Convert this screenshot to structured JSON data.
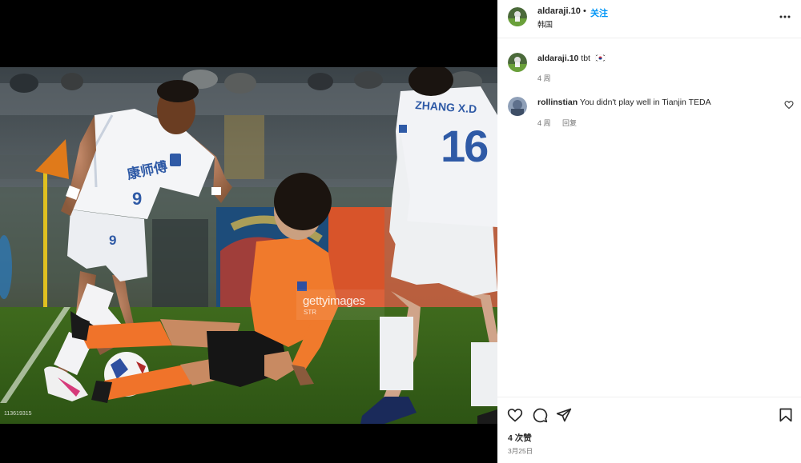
{
  "media": {
    "watermark": "gettyimages",
    "watermark_credit": "STR",
    "image_id": "113619315",
    "jersey_print_front": "康师傅",
    "front_number": "9",
    "back_name": "ZHANG X.D",
    "back_number": "16",
    "shorts_number": "9"
  },
  "post": {
    "username": "aldaraji.10",
    "dot": "•",
    "follow_label": "关注",
    "location": "韩国"
  },
  "comments": [
    {
      "username": "aldaraji.10",
      "text": "tbt",
      "flag": "south-korea-flag",
      "time": "4 周"
    },
    {
      "username": "rollinstian",
      "text": "You didn't play well in Tianjin TEDA",
      "time": "4 周",
      "reply_label": "回复"
    }
  ],
  "likes": "4 次赞",
  "date": "3月25日",
  "icons": {
    "more": "more-horizontal-icon",
    "like": "heart-icon",
    "comment": "comment-icon",
    "share": "send-icon",
    "save": "bookmark-icon"
  },
  "colors": {
    "accent": "#0095f6",
    "text_primary": "#262626",
    "text_secondary": "#737373",
    "divider": "#efefef"
  }
}
